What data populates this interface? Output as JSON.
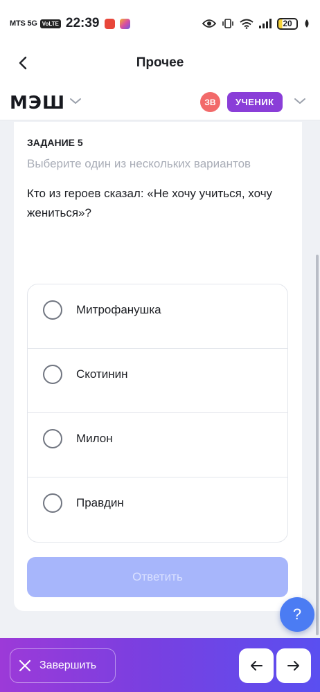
{
  "status_bar": {
    "carrier": "MTS 5G",
    "volte": "VoLTE",
    "time": "22:39",
    "battery": "20"
  },
  "header": {
    "title": "Прочее"
  },
  "app_bar": {
    "logo": "МЭШ",
    "avatar_initials": "ЗВ",
    "role": "УЧЕНИК"
  },
  "task": {
    "label": "ЗАДАНИЕ 5",
    "hint": "Выберите один из нескольких вариантов",
    "question": "Кто из героев сказал: «Не хочу учиться, хочу жениться»?",
    "options": [
      {
        "label": "Митрофанушка"
      },
      {
        "label": "Скотинин"
      },
      {
        "label": "Милон"
      },
      {
        "label": "Правдин"
      }
    ],
    "answer_button": "Ответить"
  },
  "help_button": "?",
  "bottom_bar": {
    "finish_label": "Завершить"
  },
  "colors": {
    "accent_purple": "#8a3ed8",
    "answer_disabled": "#a7b6fb",
    "help_blue": "#4b7cf3",
    "avatar_red": "#f26a6a"
  }
}
